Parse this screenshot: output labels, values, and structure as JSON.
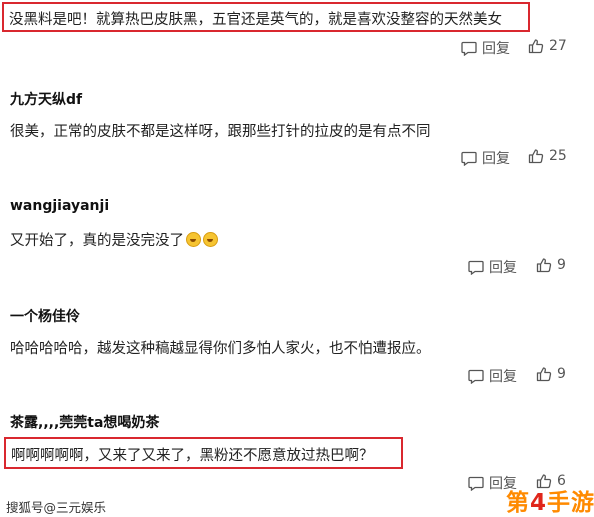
{
  "comments": [
    {
      "username": "",
      "text": "没黑料是吧！就算热巴皮肤黑，五官还是英气的，就是喜欢没整容的天然美女",
      "reply_label": "回复",
      "like_count": "27"
    },
    {
      "username": "九方天纵df",
      "text": "很美，正常的皮肤不都是这样呀，跟那些打针的拉皮的是有点不同",
      "reply_label": "回复",
      "like_count": "25"
    },
    {
      "username": "wangjiayanji",
      "text": "又开始了，真的是没完没了",
      "emojis": [
        "laughing-crying-emoji",
        "laughing-crying-emoji"
      ],
      "reply_label": "回复",
      "like_count": "9"
    },
    {
      "username": "一个杨佳伶",
      "text": "哈哈哈哈哈，越发这种稿越显得你们多怕人家火，也不怕遭报应。",
      "reply_label": "回复",
      "like_count": "9"
    },
    {
      "username": "茶露,,,,莞莞ta想喝奶茶",
      "text": "啊啊啊啊啊，又来了又来了，黑粉还不愿意放过热巴啊？",
      "reply_label": "回复",
      "like_count": "6"
    }
  ],
  "footer": {
    "source": "搜狐号@三元娱乐"
  },
  "watermark": {
    "text_prefix": "第",
    "text_number": "4",
    "text_suffix": "手游"
  },
  "colors": {
    "highlight_border": "#d9282f",
    "action_text": "#555555",
    "logo_orange": "#ff8a00",
    "logo_red": "#e0261b"
  }
}
